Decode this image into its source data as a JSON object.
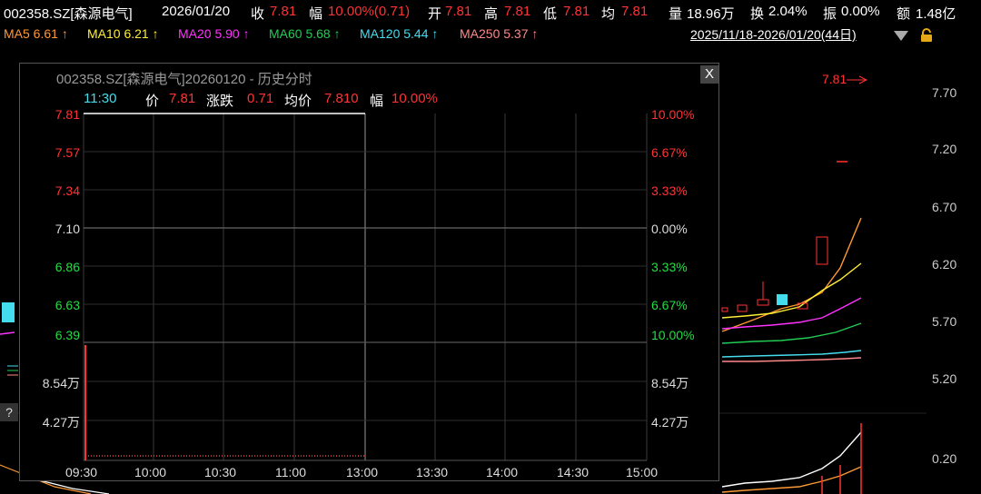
{
  "header": {
    "code": "002358.SZ[森源电气]",
    "date": "2026/01/20",
    "close_label": "收",
    "close_value": "7.81",
    "change_label": "幅",
    "change_value": "10.00%(0.71)",
    "open_label": "开",
    "open_value": "7.81",
    "high_label": "高",
    "high_value": "7.81",
    "low_label": "低",
    "low_value": "7.81",
    "avg_label": "均",
    "avg_value": "7.81",
    "volume_label": "量",
    "volume_value": "18.96万",
    "turnover_label": "换",
    "turnover_value": "2.04%",
    "amplitude_label": "振",
    "amplitude_value": "0.00%",
    "amount_label": "额",
    "amount_value": "1.48亿"
  },
  "ma_bar": {
    "items": [
      {
        "label": "MA5 6.61",
        "arrow": "↑",
        "color": "#ff9933"
      },
      {
        "label": "MA10 6.21",
        "arrow": "↑",
        "color": "#ffee33"
      },
      {
        "label": "MA20 5.90",
        "arrow": "↑",
        "color": "#ff33ff"
      },
      {
        "label": "MA60 5.68",
        "arrow": "↑",
        "color": "#22cc55"
      },
      {
        "label": "MA120 5.44",
        "arrow": "↑",
        "color": "#44ddee"
      },
      {
        "label": "MA250 5.37",
        "arrow": "↑",
        "color": "#ff8888"
      }
    ],
    "date_range": "2025/11/18-2026/01/20(44日)"
  },
  "bg_chart": {
    "y_labels": [
      "7.70",
      "7.20",
      "6.70",
      "6.20",
      "5.70",
      "5.20",
      "0.20"
    ],
    "max_price_tag": "7.81"
  },
  "popup": {
    "title": "002358.SZ[森源电气]20260120 - 历史分时",
    "close_label": "X",
    "help_label": "?",
    "info": {
      "time": "11:30",
      "price_label": "价",
      "price_value": "7.81",
      "change_label": "涨跌",
      "change_value": "0.71",
      "avg_label": "均价",
      "avg_value": "7.810",
      "pct_label": "幅",
      "pct_value": "10.00%"
    },
    "left_labels": [
      {
        "text": "7.81",
        "color": "#ff3333"
      },
      {
        "text": "7.57",
        "color": "#ff3333"
      },
      {
        "text": "7.34",
        "color": "#ff3333"
      },
      {
        "text": "7.10",
        "color": "#dddddd"
      },
      {
        "text": "6.86",
        "color": "#22dd44"
      },
      {
        "text": "6.63",
        "color": "#22dd44"
      },
      {
        "text": "6.39",
        "color": "#22dd44"
      }
    ],
    "right_labels": [
      {
        "text": "10.00%",
        "color": "#ff3333"
      },
      {
        "text": "6.67%",
        "color": "#ff3333"
      },
      {
        "text": "3.33%",
        "color": "#ff3333"
      },
      {
        "text": "0.00%",
        "color": "#dddddd"
      },
      {
        "text": "3.33%",
        "color": "#22dd44"
      },
      {
        "text": "6.67%",
        "color": "#22dd44"
      },
      {
        "text": "10.00%",
        "color": "#22dd44"
      }
    ],
    "vol_labels": [
      "8.54万",
      "4.27万"
    ],
    "x_labels": [
      "09:30",
      "10:00",
      "10:30",
      "11:00",
      "13:00",
      "13:30",
      "14:00",
      "14:30",
      "15:00"
    ]
  }
}
